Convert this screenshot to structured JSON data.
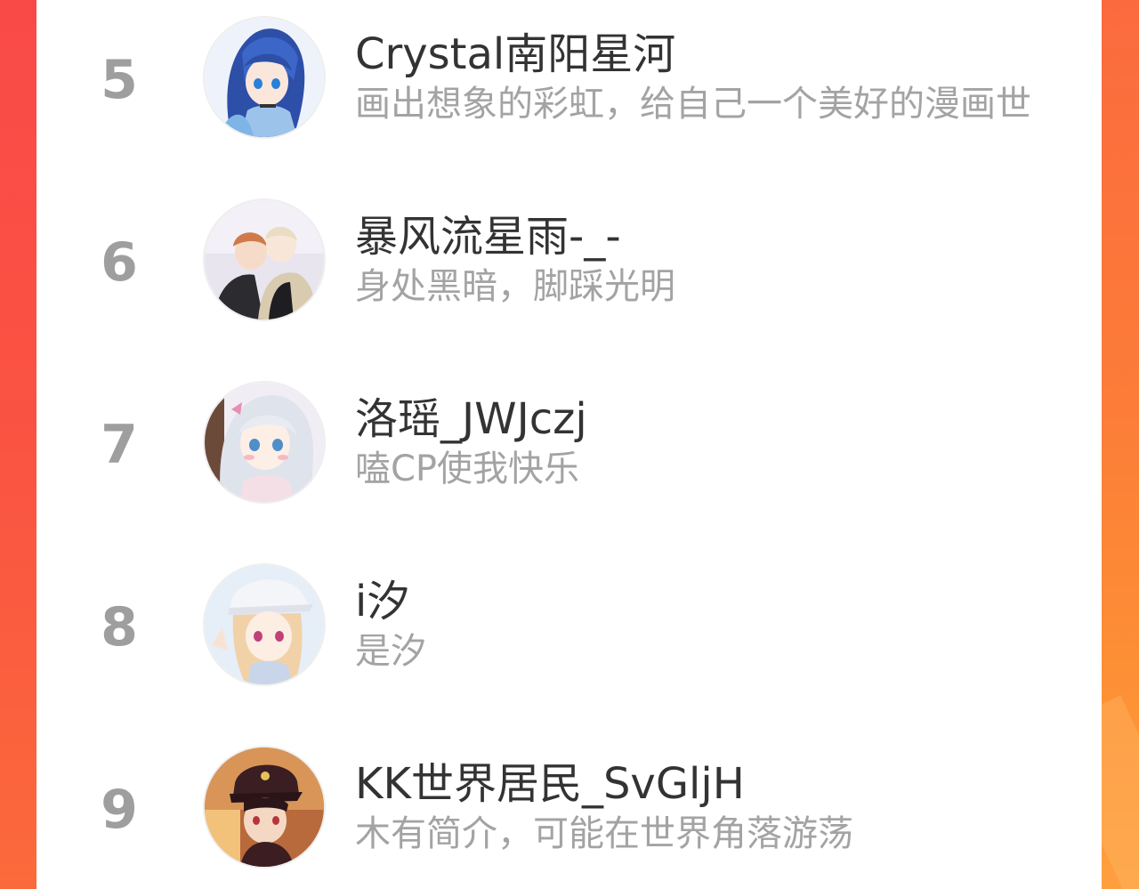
{
  "theme": {
    "accent": "#fb5c3f",
    "card_background": "#ffffff",
    "rank_color": "#9e9e9e",
    "name_color": "#333333",
    "bio_color": "#a3a3a3"
  },
  "ranking": {
    "entries": [
      {
        "rank": "5",
        "name": "Crystal南阳星河",
        "bio": "画出想象的彩虹，给自己一个美好的漫画世",
        "avatar": "anime-girl-blue-hair-avatar"
      },
      {
        "rank": "6",
        "name": "暴风流星雨-_-",
        "bio": "身处黑暗，脚踩光明",
        "avatar": "anime-couple-avatar"
      },
      {
        "rank": "7",
        "name": "洛瑶_JWJczj",
        "bio": "嗑CP使我快乐",
        "avatar": "anime-girl-silver-hair-avatar"
      },
      {
        "rank": "8",
        "name": "i汐",
        "bio": "是汐",
        "avatar": "anime-girl-white-cap-avatar"
      },
      {
        "rank": "9",
        "name": "KK世界居民_SvGljH",
        "bio": "木有简介，可能在世界角落游荡",
        "avatar": "anime-boy-school-cap-avatar"
      }
    ]
  }
}
